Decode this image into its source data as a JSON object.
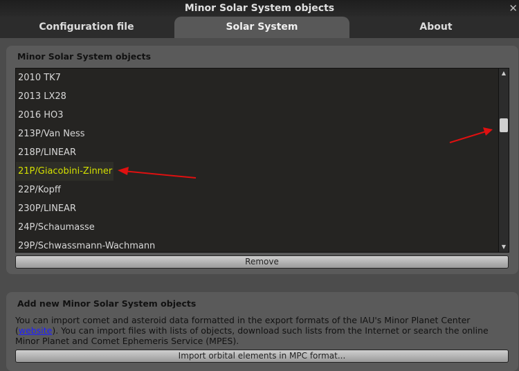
{
  "window": {
    "title": "Minor Solar System objects",
    "close_icon": "close-icon"
  },
  "tabs": [
    {
      "label": "Configuration file"
    },
    {
      "label": "Solar System",
      "active": true
    },
    {
      "label": "About"
    }
  ],
  "objects_group": {
    "title": "Minor Solar System objects",
    "items": [
      "2010 TK7",
      "2013 LX28",
      "2016 HO3",
      "213P/Van Ness",
      "218P/LINEAR",
      "21P/Giacobini-Zinner",
      "22P/Kopff",
      "230P/LINEAR",
      "24P/Schaumasse",
      "29P/Schwassmann-Wachmann"
    ],
    "selected": "21P/Giacobini-Zinner",
    "remove_label": "Remove"
  },
  "add_group": {
    "title": "Add new Minor Solar System objects",
    "desc_1": "You can import comet and asteroid data formatted in the export formats of the IAU's Minor Planet Center (",
    "link": "website",
    "desc_2": "). You can import files with lists of objects, download such lists from the Internet or search the online Minor Planet and Comet Ephemeris Service (MPES).",
    "import_label": "Import orbital elements in MPC format..."
  },
  "colors": {
    "selected_text": "#d4e000",
    "arrow": "#e01010"
  }
}
